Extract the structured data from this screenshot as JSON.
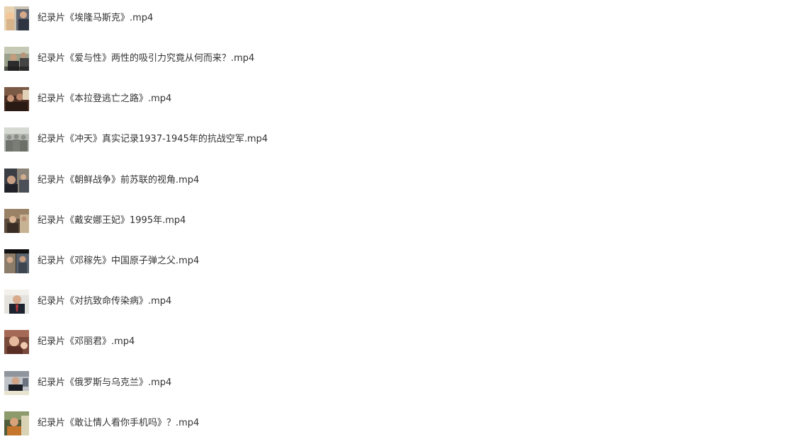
{
  "files": [
    {
      "name": "纪录片《埃隆马斯克》.mp4",
      "thumbnail": "video-thumbnail-icon"
    },
    {
      "name": "纪录片《爱与性》两性的吸引力究竟从何而来？.mp4",
      "thumbnail": "video-thumbnail-icon"
    },
    {
      "name": "纪录片《本拉登逃亡之路》.mp4",
      "thumbnail": "video-thumbnail-icon"
    },
    {
      "name": "纪录片《冲天》真实记录1937-1945年的抗战空军.mp4",
      "thumbnail": "video-thumbnail-icon"
    },
    {
      "name": "纪录片《朝鲜战争》前苏联的视角.mp4",
      "thumbnail": "video-thumbnail-icon"
    },
    {
      "name": "纪录片《戴安娜王妃》1995年.mp4",
      "thumbnail": "video-thumbnail-icon"
    },
    {
      "name": "纪录片《邓稼先》中国原子弹之父.mp4",
      "thumbnail": "video-thumbnail-icon"
    },
    {
      "name": "纪录片《对抗致命传染病》.mp4",
      "thumbnail": "video-thumbnail-icon"
    },
    {
      "name": "纪录片《邓丽君》.mp4",
      "thumbnail": "video-thumbnail-icon"
    },
    {
      "name": "纪录片《俄罗斯与乌克兰》.mp4",
      "thumbnail": "video-thumbnail-icon"
    },
    {
      "name": "纪录片《敢让情人看你手机吗》？.mp4",
      "thumbnail": "video-thumbnail-icon"
    }
  ],
  "colors": {
    "text": "#333333",
    "background": "#ffffff"
  }
}
